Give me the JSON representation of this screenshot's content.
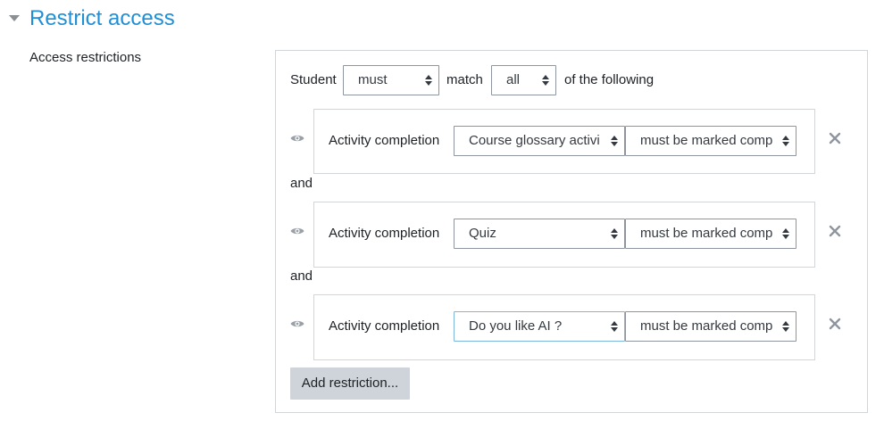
{
  "section": {
    "title": "Restrict access",
    "toggle_icon": "caret-down-icon"
  },
  "field": {
    "label": "Access restrictions"
  },
  "header": {
    "student_label": "Student",
    "must_select": "must",
    "match_label": "match",
    "all_select": "all",
    "suffix": "of the following"
  },
  "connector": "and",
  "conditions": [
    {
      "type_label": "Activity completion",
      "activity": "Course glossary activi",
      "status": "must be marked comp"
    },
    {
      "type_label": "Activity completion",
      "activity": "Quiz",
      "status": "must be marked comp"
    },
    {
      "type_label": "Activity completion",
      "activity": "Do you like AI ?",
      "status": "must be marked comp"
    }
  ],
  "add_button": "Add restriction...",
  "colors": {
    "title": "#1f8fd6",
    "border": "#d3d6d9",
    "button_bg": "#ced4da"
  }
}
